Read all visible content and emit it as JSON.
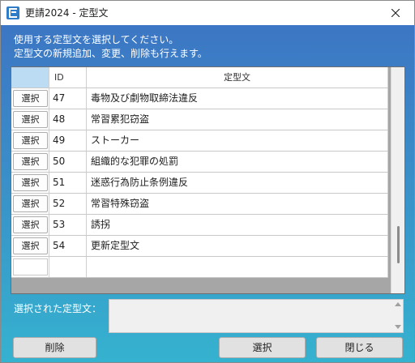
{
  "window": {
    "title": "更請2024 - 定型文"
  },
  "instructions": {
    "line1": "使用する定型文を選択してください。",
    "line2": "定型文の新規追加、変更、削除も行えます。"
  },
  "table": {
    "headers": {
      "id": "ID",
      "text": "定型文"
    },
    "row_button_label": "選択",
    "rows": [
      {
        "id": "47",
        "text": "毒物及び劇物取締法違反"
      },
      {
        "id": "48",
        "text": "常習累犯窃盗"
      },
      {
        "id": "49",
        "text": "ストーカー"
      },
      {
        "id": "50",
        "text": "組織的な犯罪の処罰"
      },
      {
        "id": "51",
        "text": "迷惑行為防止条例違反"
      },
      {
        "id": "52",
        "text": "常習特殊窃盗"
      },
      {
        "id": "53",
        "text": "誘拐"
      },
      {
        "id": "54",
        "text": "更新定型文"
      }
    ]
  },
  "selected": {
    "label": "選択された定型文：",
    "value": ""
  },
  "buttons": {
    "delete": "削除",
    "select": "選択",
    "close": "閉じる"
  }
}
